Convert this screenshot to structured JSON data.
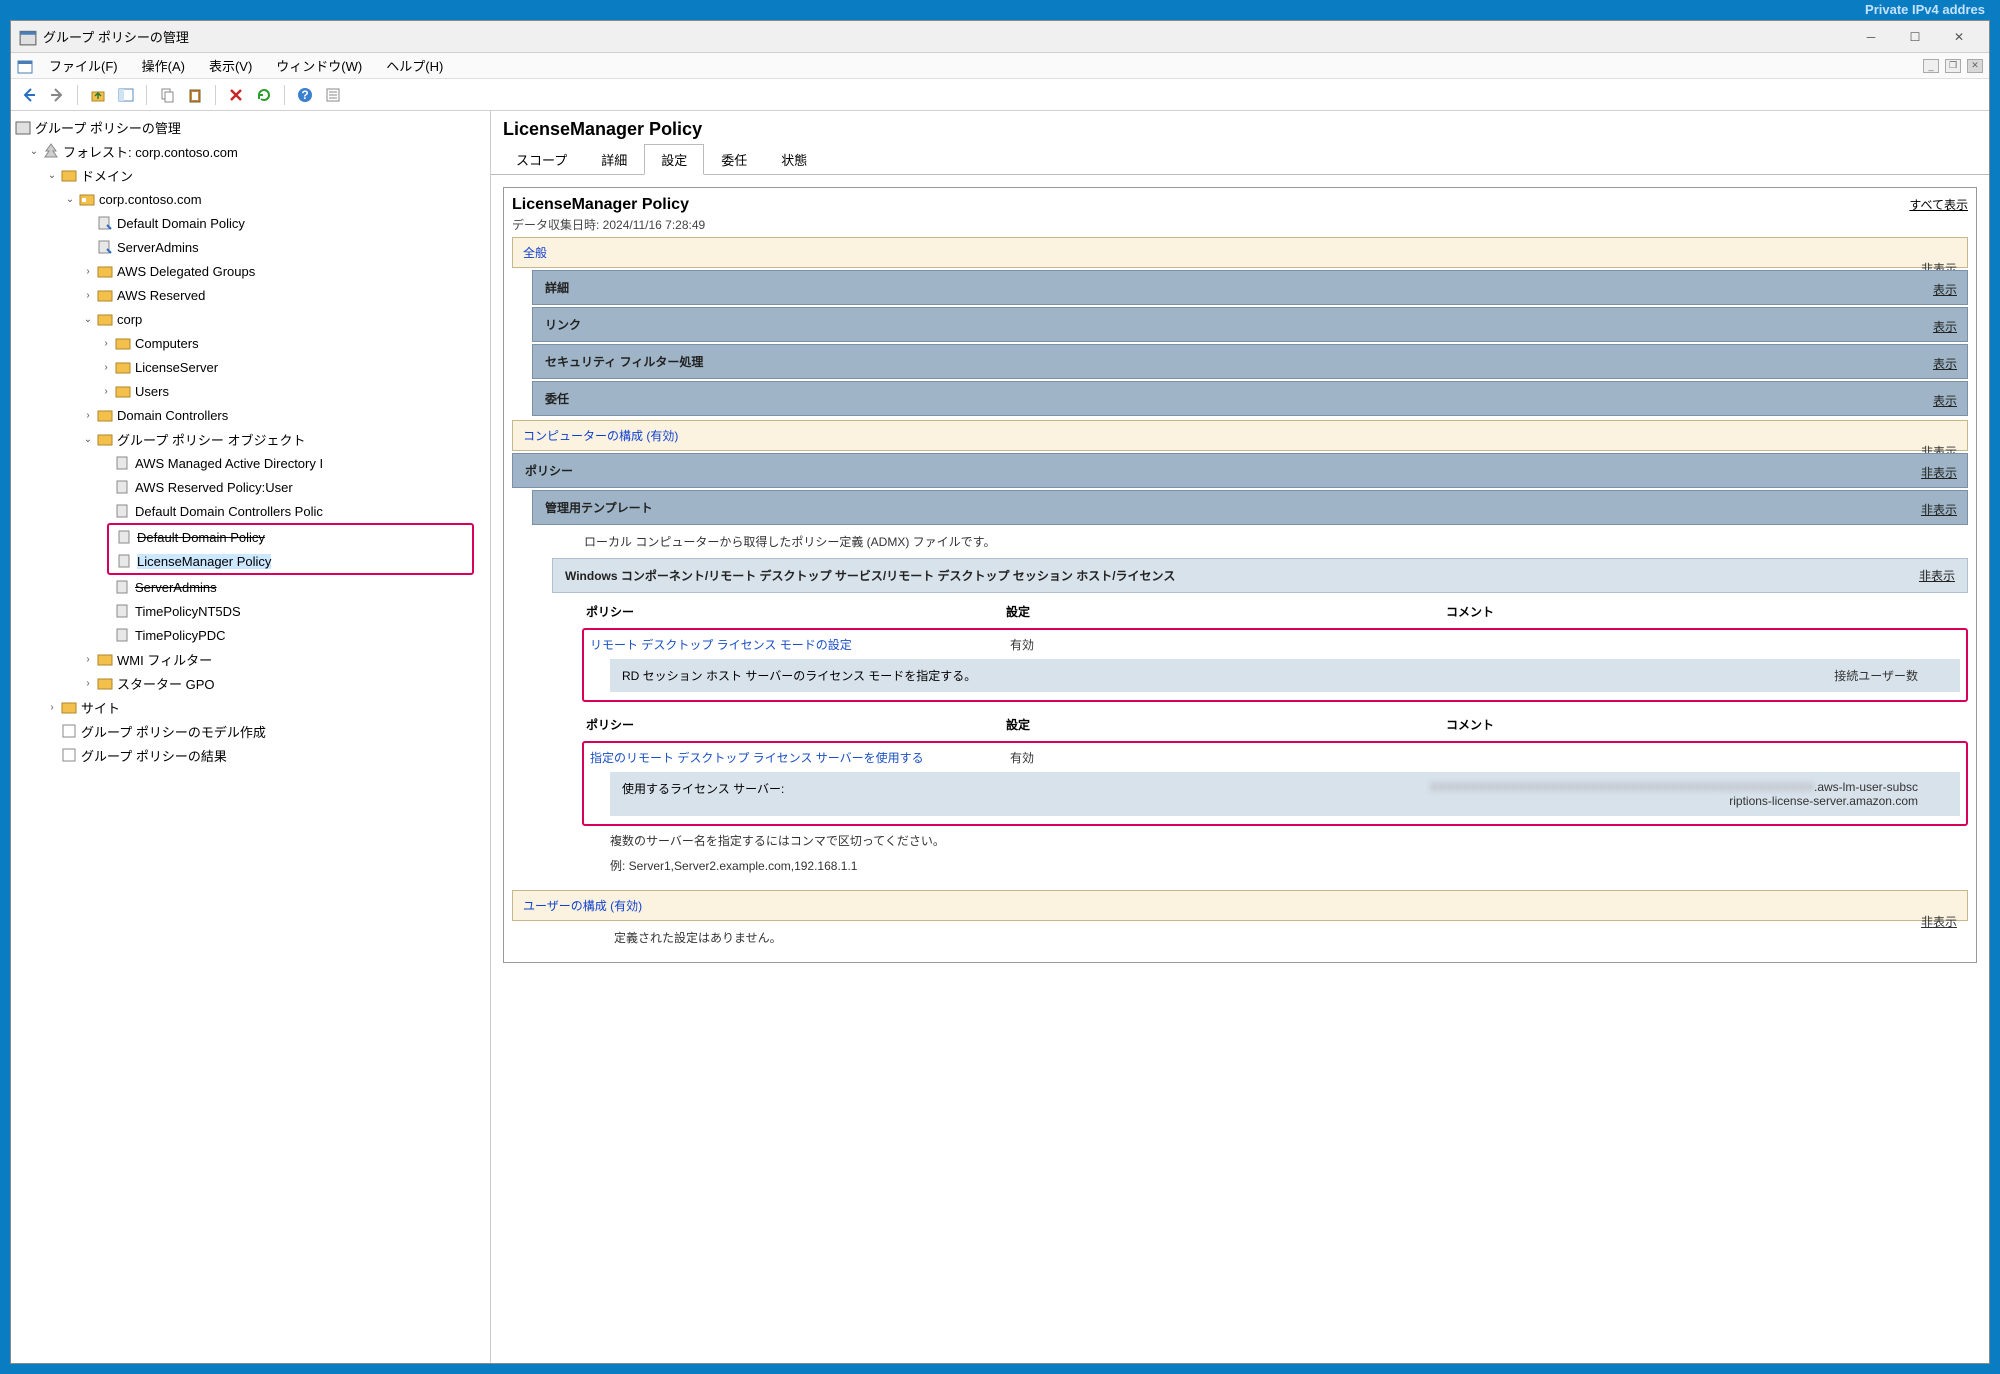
{
  "private_ip_hint": "Private IPv4 addres",
  "window_title": "グループ ポリシーの管理",
  "menu": {
    "file": "ファイル(F)",
    "action": "操作(A)",
    "view": "表示(V)",
    "window": "ウィンドウ(W)",
    "help": "ヘルプ(H)"
  },
  "tree": {
    "root": "グループ ポリシーの管理",
    "forest": "フォレスト: corp.contoso.com",
    "domains": "ドメイン",
    "domain": "corp.contoso.com",
    "items": [
      "Default Domain Policy",
      "ServerAdmins",
      "AWS Delegated Groups",
      "AWS Reserved",
      "corp",
      "Computers",
      "LicenseServer",
      "Users",
      "Domain Controllers",
      "グループ ポリシー オブジェクト",
      "AWS Managed Active Directory I",
      "AWS Reserved Policy:User",
      "Default Domain Controllers Polic",
      "Default Domain Policy",
      "LicenseManager Policy",
      "ServerAdmins",
      "TimePolicyNT5DS",
      "TimePolicyPDC",
      "WMI フィルター",
      "スターター GPO"
    ],
    "sites": "サイト",
    "gpmodel": "グループ ポリシーのモデル作成",
    "gpresult": "グループ ポリシーの結果"
  },
  "policy": {
    "title": "LicenseManager Policy",
    "tabs": {
      "scope": "スコープ",
      "details": "詳細",
      "settings": "設定",
      "delegation": "委任",
      "status": "状態"
    },
    "heading": "LicenseManager Policy",
    "collected": "データ収集日時: 2024/11/16 7:28:49",
    "show_all": "すべて表示",
    "general": "全般",
    "hide": "非表示",
    "show": "表示",
    "detail": "詳細",
    "links": "リンク",
    "secfilter": "セキュリティ フィルター処理",
    "delegation": "委任",
    "compcfg": "コンピューターの構成 (有効)",
    "policies": "ポリシー",
    "admintmpl": "管理用テンプレート",
    "admx_note": "ローカル コンピューターから取得したポリシー定義 (ADMX) ファイルです。",
    "rds_path": "Windows コンポーネント/リモート デスクトップ サービス/リモート デスクトップ セッション ホスト/ライセンス",
    "col_policy": "ポリシー",
    "col_setting": "設定",
    "col_comment": "コメント",
    "p1": "リモート デスクトップ ライセンス モードの設定",
    "p1_state": "有効",
    "p1_detail": "RD セッション ホスト サーバーのライセンス モードを指定する。",
    "p1_val": "接続ユーザー数",
    "p2": "指定のリモート デスクトップ ライセンス サーバーを使用する",
    "p2_state": "有効",
    "p2_detail": "使用するライセンス サーバー:",
    "p2_val": ".aws-lm-user-subscriptions-license-server.amazon.com",
    "note1": "複数のサーバー名を指定するにはコンマで区切ってください。",
    "note2": "例: Server1,Server2.example.com,192.168.1.1",
    "usercfg": "ユーザーの構成 (有効)",
    "nosettings": "定義された設定はありません。"
  }
}
